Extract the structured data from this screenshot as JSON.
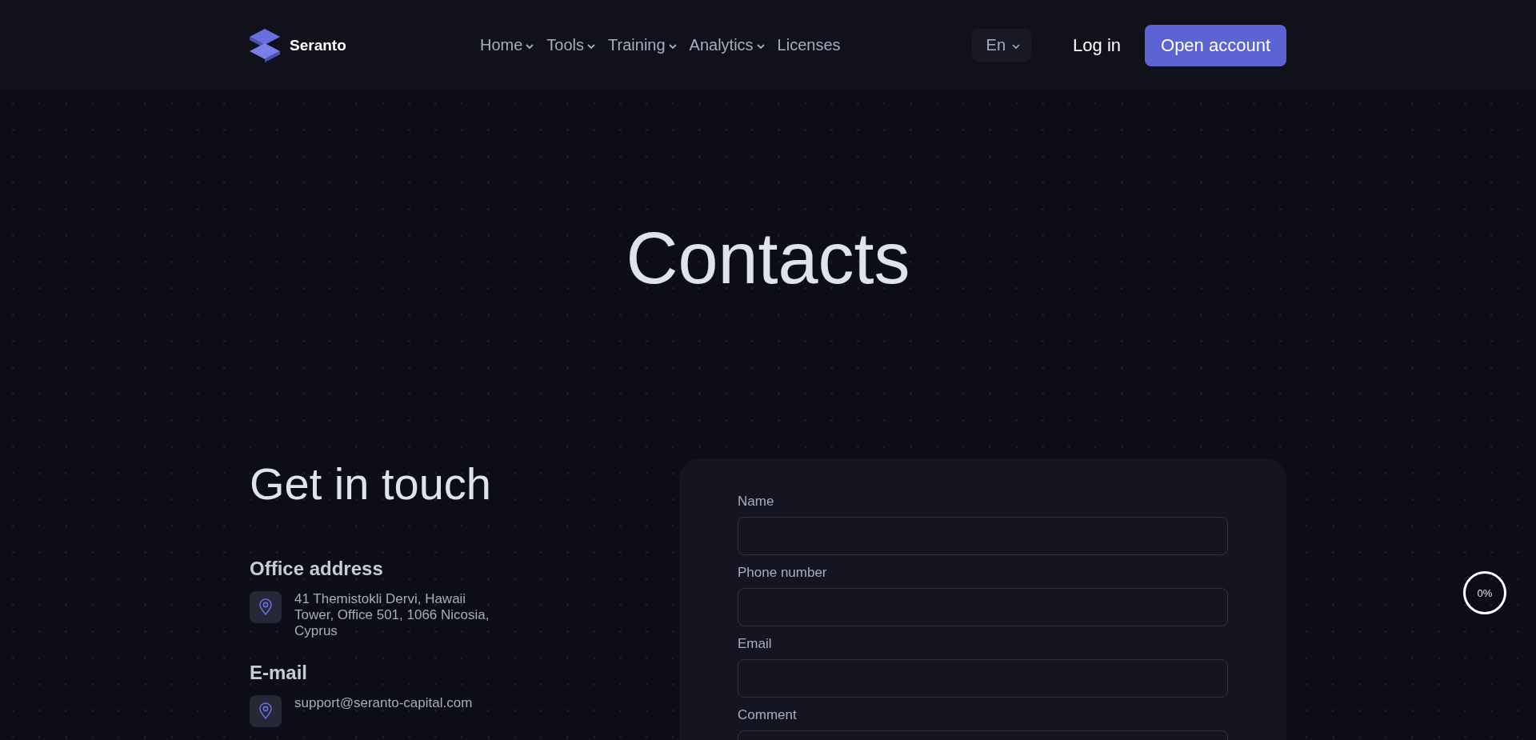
{
  "header": {
    "logo": {
      "name": "Seranto"
    },
    "nav": [
      {
        "label": "Home",
        "dropdown": true
      },
      {
        "label": "Tools",
        "dropdown": true
      },
      {
        "label": "Training",
        "dropdown": true
      },
      {
        "label": "Analytics",
        "dropdown": true
      },
      {
        "label": "Licenses",
        "dropdown": false
      }
    ],
    "language": "En",
    "login": "Log in",
    "cta": "Open account"
  },
  "page_title": "Contacts",
  "contact": {
    "title": "Get in touch",
    "sections": [
      {
        "heading": "Office address",
        "text": "41 Themistokli Dervi, Hawaii Tower, Office 501, 1066 Nicosia, Cyprus"
      },
      {
        "heading": "E-mail",
        "text": "support@seranto-capital.com"
      }
    ]
  },
  "form": {
    "fields": [
      {
        "label": "Name"
      },
      {
        "label": "Phone number"
      },
      {
        "label": "Email"
      },
      {
        "label": "Comment"
      }
    ]
  },
  "scroll_progress": {
    "label": "0%"
  }
}
